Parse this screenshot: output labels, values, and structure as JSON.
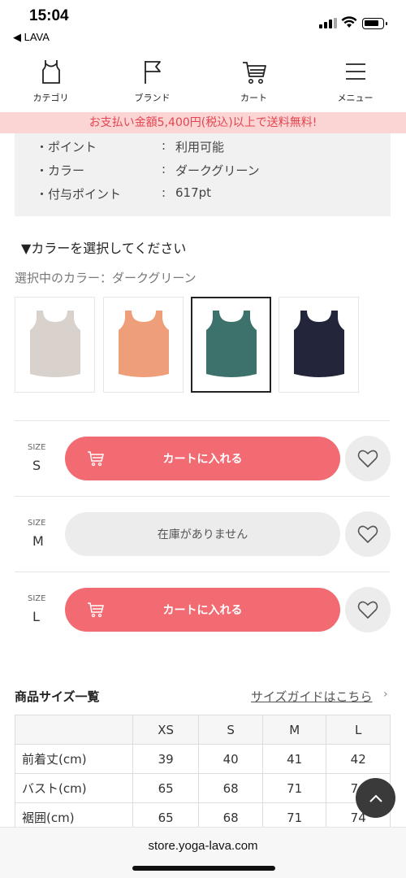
{
  "status_bar": {
    "time": "15:04",
    "back_label": "◀ LAVA"
  },
  "nav": {
    "items": [
      {
        "label": "カテゴリ",
        "icon": "tank-top-icon"
      },
      {
        "label": "ブランド",
        "icon": "flag-icon"
      },
      {
        "label": "カート",
        "icon": "cart-icon"
      },
      {
        "label": "メニュー",
        "icon": "hamburger-menu-icon"
      }
    ]
  },
  "banner": {
    "text": "お支払い金額5,400円(税込)以上で送料無料!"
  },
  "info": {
    "rows": [
      {
        "key": "・ポイント",
        "sep": ":",
        "value": "利用可能"
      },
      {
        "key": "・カラー",
        "sep": ":",
        "value": "ダークグリーン"
      },
      {
        "key": "・付与ポイント",
        "sep": ":",
        "value": "617pt"
      }
    ]
  },
  "color_select": {
    "title": "▼カラーを選択してください",
    "selected_text": "選択中のカラー：ダークグリーン",
    "swatches": [
      {
        "color": "#d9d2cc",
        "selected": false
      },
      {
        "color": "#ee9e78",
        "selected": false
      },
      {
        "color": "#3d726c",
        "selected": true
      },
      {
        "color": "#23263a",
        "selected": false
      }
    ]
  },
  "sizes": [
    {
      "label_small": "SIZE",
      "size": "S",
      "button": "カートに入れる",
      "in_stock": true
    },
    {
      "label_small": "SIZE",
      "size": "M",
      "button": "在庫がありません",
      "in_stock": false
    },
    {
      "label_small": "SIZE",
      "size": "L",
      "button": "カートに入れる",
      "in_stock": true
    }
  ],
  "size_table": {
    "title": "商品サイズ一覧",
    "guide_link": "サイズガイドはこちら",
    "guide_chevron": "›",
    "columns": [
      "",
      "XS",
      "S",
      "M",
      "L"
    ],
    "rows": [
      {
        "label": "前着丈(cm)",
        "values": [
          "39",
          "40",
          "41",
          "42"
        ]
      },
      {
        "label": "バスト(cm)",
        "values": [
          "65",
          "68",
          "71",
          "74"
        ]
      },
      {
        "label": "裾囲(cm)",
        "values": [
          "65",
          "68",
          "71",
          "74"
        ]
      }
    ]
  },
  "url_bar": {
    "url": "store.yoga-lava.com"
  },
  "colors": {
    "accent": "#f26b72",
    "banner_bg": "#fbd4d4",
    "banner_text": "#e4454f"
  }
}
